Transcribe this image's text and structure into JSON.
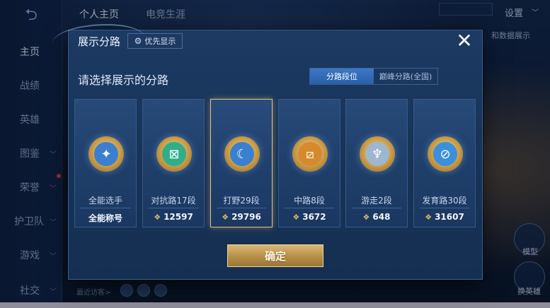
{
  "background": {
    "top_tabs": [
      "个人主页",
      "电竞生涯"
    ],
    "settings_label": "设置",
    "behind_text": "和数据展示",
    "sidebar_items": [
      "主页",
      "战绩",
      "英雄",
      "图鉴",
      "荣誉",
      "护卫队",
      "游戏",
      "社交"
    ],
    "right_buttons": [
      "模型",
      "换英雄"
    ],
    "recent_visitors_label": "最近访客>"
  },
  "modal": {
    "title": "展示分路",
    "priority_button": "优先显示",
    "close_icon": "close-icon",
    "subtitle": "请选择展示的分路",
    "toggle": [
      "分路段位",
      "巅峰分路(全国)"
    ],
    "toggle_selected": "分路段位",
    "lanes": [
      {
        "name": "全能选手",
        "value": "全能称号",
        "icon": "all-round-emblem-icon",
        "gem": false,
        "selected": false,
        "color": "#3a7fd0"
      },
      {
        "name": "对抗路17段",
        "value": "12597",
        "icon": "clash-lane-emblem-icon",
        "gem": true,
        "selected": false,
        "color": "#2fae8a"
      },
      {
        "name": "打野29段",
        "value": "29796",
        "icon": "jungle-emblem-icon",
        "gem": true,
        "selected": true,
        "color": "#3a7fd0"
      },
      {
        "name": "中路8段",
        "value": "3672",
        "icon": "mid-lane-emblem-icon",
        "gem": true,
        "selected": false,
        "color": "#d68a2c"
      },
      {
        "name": "游走2段",
        "value": "648",
        "icon": "roam-emblem-icon",
        "gem": true,
        "selected": false,
        "color": "#9fb6cf"
      },
      {
        "name": "发育路30段",
        "value": "31607",
        "icon": "farm-lane-emblem-icon",
        "gem": true,
        "selected": false,
        "color": "#3a8fe0"
      }
    ],
    "confirm_label": "确定"
  },
  "colors": {
    "accent_gold": "#e3c27a",
    "toggle_on": "#2b5fa8",
    "panel": "#183458"
  }
}
